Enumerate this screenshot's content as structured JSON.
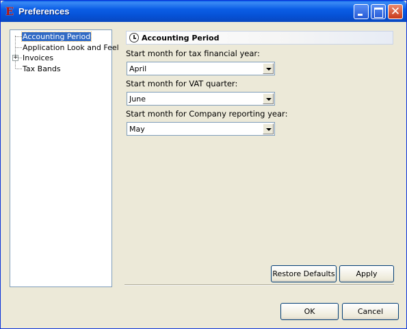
{
  "window": {
    "title": "Preferences",
    "app_icon_glyph": "E",
    "controls": [
      "minimize-icon",
      "maximize-icon",
      "close-icon"
    ]
  },
  "tree": {
    "items": [
      {
        "label": "Accounting Period",
        "selected": true
      },
      {
        "label": "Application Look and Feel"
      },
      {
        "label": "Invoices",
        "expander": "+"
      },
      {
        "label": "Tax Bands"
      }
    ]
  },
  "panel": {
    "title": "Accounting Period",
    "icon": "clock-icon",
    "fields": [
      {
        "label": "Start month for tax financial year:",
        "value": "April"
      },
      {
        "label": "Start month for VAT quarter:",
        "value": "June"
      },
      {
        "label": "Start month for Company reporting year:",
        "value": "May"
      }
    ]
  },
  "buttons": {
    "restore_defaults": "Restore Defaults",
    "apply": "Apply",
    "ok": "OK",
    "cancel": "Cancel"
  }
}
